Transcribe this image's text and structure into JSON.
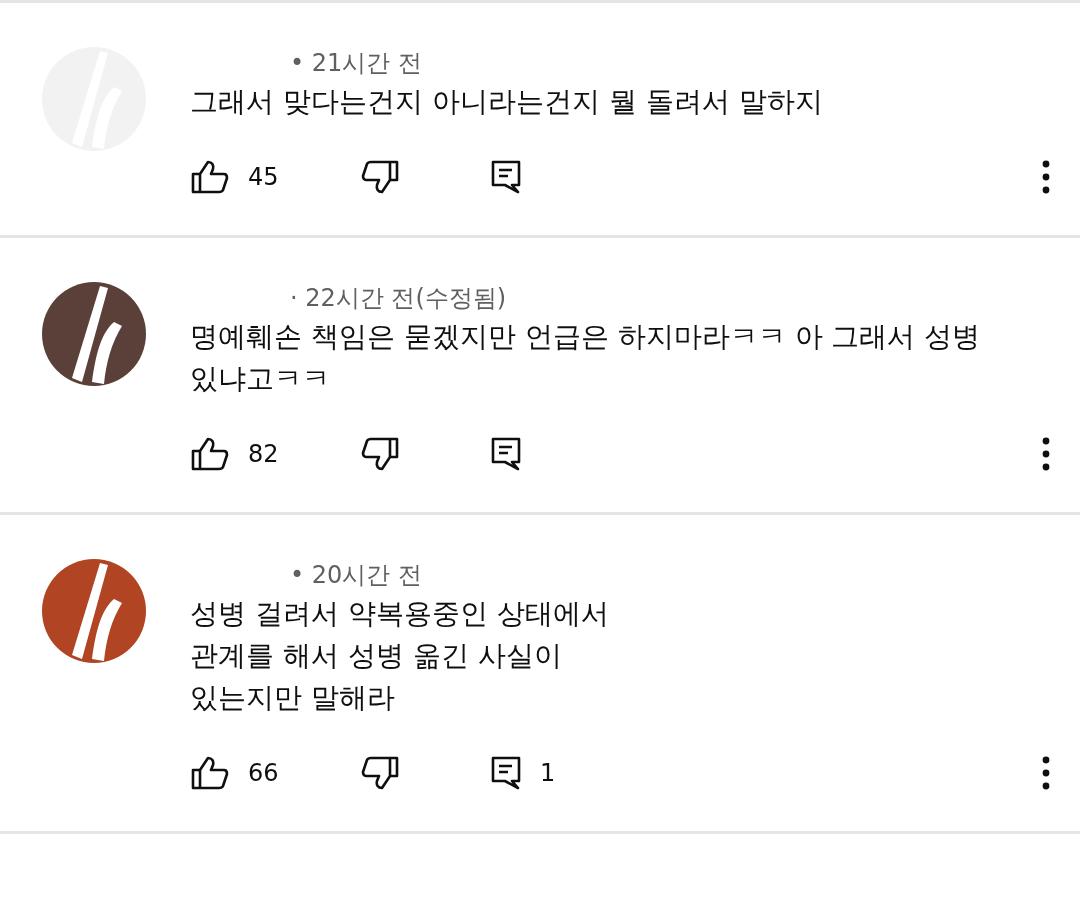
{
  "comments": [
    {
      "color": "#f2f2f2",
      "meta": "• 21시간 전",
      "text": "그래서 맞다는건지 아니라는건지 뭘 돌려서 말하지",
      "likes": "45"
    },
    {
      "color": "#5a4038",
      "meta": "· 22시간 전(수정됨)",
      "text": "명예훼손 책임은 묻겠지만 언급은 하지마라ㅋㅋ 아 그래서 성병 있냐고ㅋㅋ",
      "likes": "82"
    },
    {
      "color": "#b04423",
      "meta": "• 20시간 전",
      "text": "성병 걸려서 약복용중인 상태에서\n관계를 해서 성병 옮긴 사실이\n있는지만 말해라",
      "likes": "66",
      "replies": "1"
    }
  ]
}
